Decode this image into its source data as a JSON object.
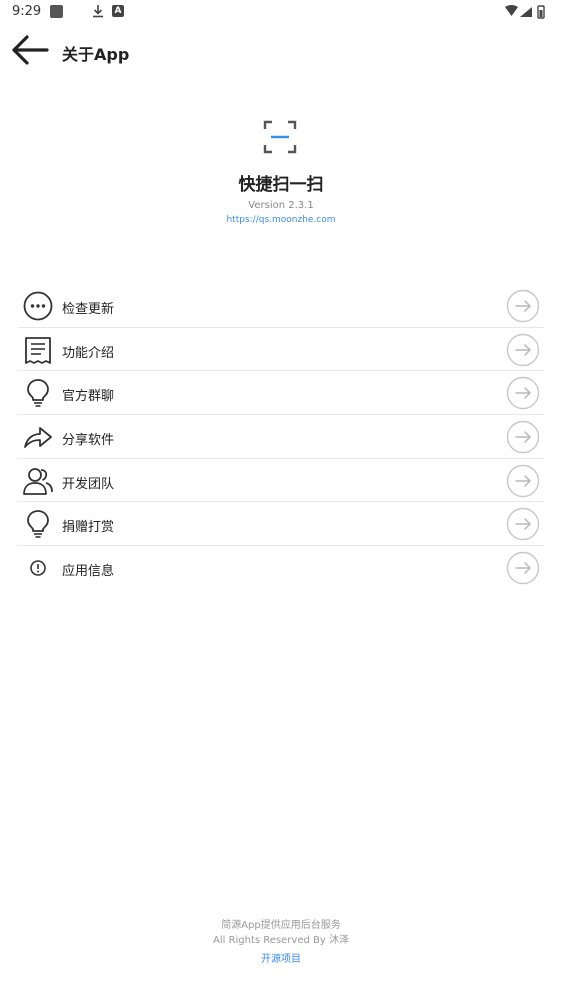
{
  "status_bar": {
    "time": "9:29",
    "a_badge": "A"
  },
  "appbar": {
    "title": "关于App",
    "back_icon": "arrow-left-icon"
  },
  "header": {
    "app_name": "快捷扫一扫",
    "version": "Version 2.3.1",
    "url": "https://qs.moonzhe.com",
    "logo_icon": "scan-frame-icon",
    "accent_color": "#3b8ee8"
  },
  "menu": {
    "items": [
      {
        "label": "检查更新",
        "icon": "more-circle-icon"
      },
      {
        "label": "功能介绍",
        "icon": "receipt-icon"
      },
      {
        "label": "官方群聊",
        "icon": "lightbulb-icon"
      },
      {
        "label": "分享软件",
        "icon": "share-arrow-icon"
      },
      {
        "label": "开发团队",
        "icon": "people-icon"
      },
      {
        "label": "捐赠打赏",
        "icon": "lightbulb-icon"
      },
      {
        "label": "应用信息",
        "icon": "info-circle-icon"
      }
    ],
    "arrow_icon": "arrow-right-circle-icon"
  },
  "footer": {
    "line1": "简源App提供应用后台服务",
    "line2": "All Rights Reserved By 沐泽",
    "link": "开源项目"
  }
}
